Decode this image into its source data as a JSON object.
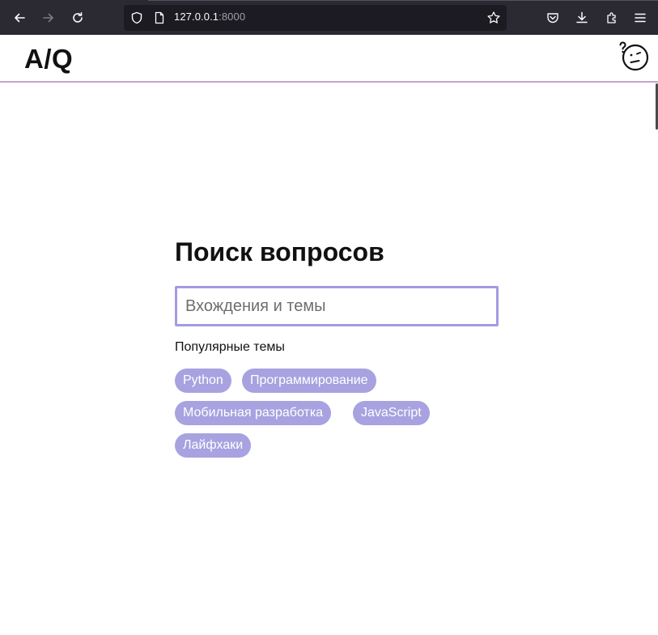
{
  "browser": {
    "url_host": "127.0.0.1",
    "url_port": ":8000"
  },
  "site": {
    "logo": "A/Q",
    "avatar_icon": "confused-face-icon"
  },
  "main": {
    "title": "Поиск вопросов",
    "search_placeholder": "Вхождения и темы",
    "popular_label": "Популярные темы",
    "tags": [
      "Python",
      "Программирование",
      "Мобильная разработка",
      "JavaScript",
      "Лайфхаки"
    ]
  },
  "colors": {
    "accent": "#a29be3",
    "tag_bg": "#a8a2e0",
    "header_border": "#c9a2cb"
  }
}
